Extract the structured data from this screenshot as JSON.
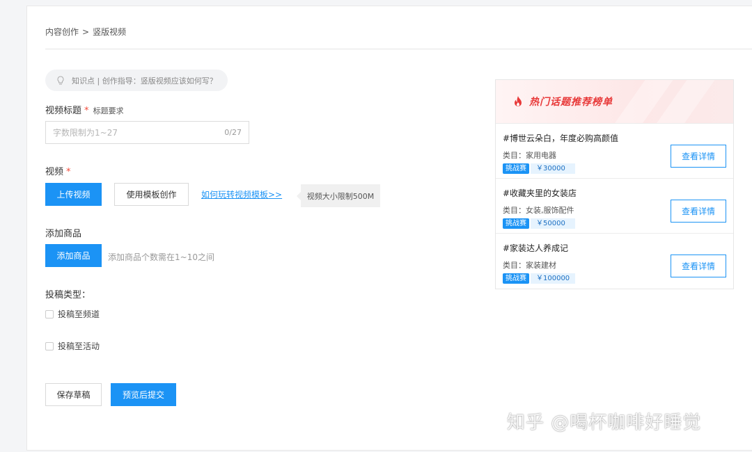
{
  "breadcrumb": {
    "parent": "内容创作",
    "separator": ">",
    "current": "竖版视频"
  },
  "tip": {
    "text": "知识点 | 创作指导：竖版视频应该如何写？",
    "icon": "lightbulb-icon"
  },
  "title_field": {
    "label": "视频标题",
    "required_mark": "*",
    "requirement": "标题要求",
    "placeholder": "字数限制为1~27",
    "value": "",
    "counter": "0/27"
  },
  "video_field": {
    "label": "视频",
    "required_mark": "*",
    "upload_label": "上传视频",
    "template_label": "使用模板创作",
    "guide_link": "如何玩转视频模板>>",
    "size_tip": "视频大小限制500M"
  },
  "product_field": {
    "label": "添加商品",
    "add_label": "添加商品",
    "hint": "添加商品个数需在1~10之间"
  },
  "submit_type": {
    "label": "投稿类型：",
    "options": [
      {
        "label": "投稿至频道",
        "checked": false
      },
      {
        "label": "投稿至活动",
        "checked": false
      }
    ]
  },
  "footer": {
    "save_label": "保存草稿",
    "submit_label": "预览后提交"
  },
  "hot_topics": {
    "title": "热门话题推荐榜单",
    "icon": "flame-icon",
    "accent_color": "#e83a3a",
    "items": [
      {
        "name": "#博世云朵白，年度必购高颜值",
        "category": "类目：家用电器",
        "badge": "挑战赛",
        "prize": "￥30000",
        "button": "查看详情"
      },
      {
        "name": "#收藏夹里的女装店",
        "category": "类目：女装,服饰配件",
        "badge": "挑战赛",
        "prize": "￥50000",
        "button": "查看详情"
      },
      {
        "name": "#家装达人养成记",
        "category": "类目：家装建材",
        "badge": "挑战赛",
        "prize": "￥100000",
        "button": "查看详情"
      }
    ]
  },
  "watermark": "知乎 @喝杯咖啡好睡觉",
  "colors": {
    "primary": "#1b93f5",
    "required": "#f24b3a"
  }
}
